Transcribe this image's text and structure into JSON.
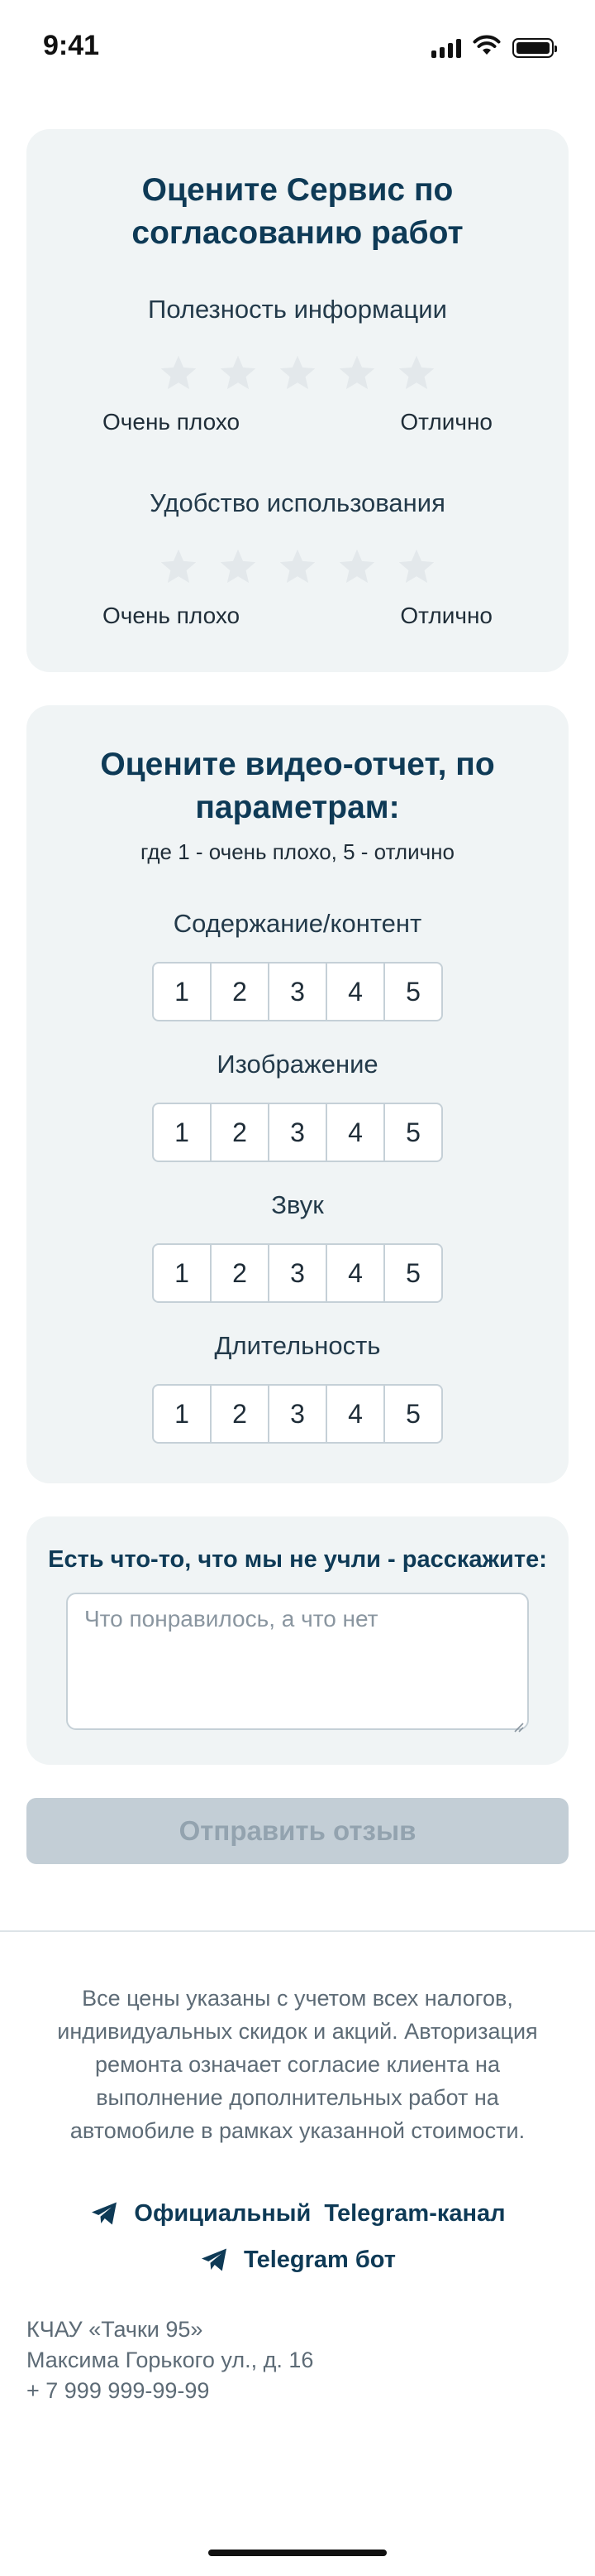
{
  "status_bar": {
    "time": "9:41"
  },
  "service_rating": {
    "title_line1": "Оцените Сервис по",
    "title_line2": "согласованию работ",
    "criteria": [
      {
        "label": "Полезность информации",
        "min_label": "Очень плохо",
        "max_label": "Отлично",
        "rating": 0,
        "max_rating": 5
      },
      {
        "label": "Удобство использования",
        "min_label": "Очень плохо",
        "max_label": "Отлично",
        "rating": 0,
        "max_rating": 5
      }
    ]
  },
  "video_rating": {
    "title_line1": "Оцените видео-отчет, по",
    "title_line2": "параметрам:",
    "subtitle": "где 1 - очень плохо, 5 - отлично",
    "scale": [
      "1",
      "2",
      "3",
      "4",
      "5"
    ],
    "criteria": [
      {
        "label": "Содержание/контент"
      },
      {
        "label": "Изображение"
      },
      {
        "label": "Звук"
      },
      {
        "label": "Длительность"
      }
    ]
  },
  "comment": {
    "label": "Есть что-то, что мы не учли - расскажите:",
    "placeholder": "Что понравилось, а что нет"
  },
  "submit": {
    "label": "Отправить отзыв",
    "enabled": false
  },
  "footer": {
    "disclaimer": "Все цены указаны с учетом всех налогов, индивидуальных скидок и акций. Авторизация ремонта означает согласие клиента на выполнение дополнительных работ на автомобиле в рамках указанной стоимости.",
    "telegram_channel": "Официальный  Telegram-канал",
    "telegram_bot": "Telegram бот",
    "company": "КЧАУ «Тачки 95»",
    "address": "Максима Горького ул., д. 16",
    "phone": "+ 7 999 999-99-99"
  },
  "colors": {
    "primary": "#0e3a56",
    "card_bg": "#f0f4f5",
    "star_inactive": "#e3e8eb",
    "button_disabled_bg": "#c3ced6",
    "button_disabled_text": "#93a3af"
  }
}
